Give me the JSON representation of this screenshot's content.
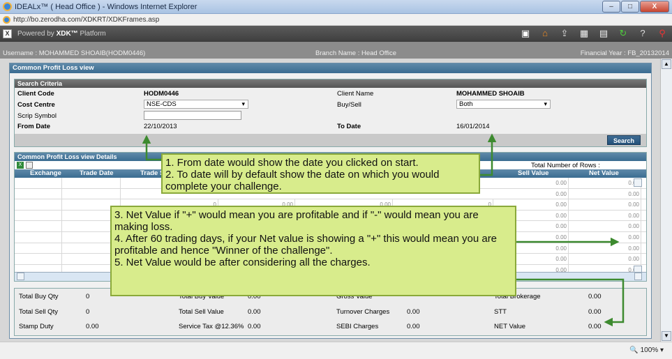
{
  "window": {
    "title": "IDEALx™ ( Head Office ) - Windows Internet Explorer",
    "minimize": "–",
    "maximize": "□",
    "close": "X"
  },
  "address": {
    "url": "http://bo.zerodha.com/XDKRT/XDKFrames.asp"
  },
  "platform": {
    "prefix": "Powered by ",
    "brand": "XDK™",
    "suffix": " Platform"
  },
  "userbar": {
    "username": "Username : MOHAMMED SHOAIB(HODM0446)",
    "branch": "Branch Name : Head Office",
    "fy": "Financial Year : FB_20132014"
  },
  "panel": {
    "title": "Common Profit Loss view"
  },
  "search": {
    "title": "Search Criteria",
    "client_code_label": "Client Code",
    "client_code": "HODM0446",
    "client_name_label": "Client Name",
    "client_name": "MOHAMMED SHOAIB",
    "cost_centre_label": "Cost Centre",
    "cost_centre": "NSE-CDS",
    "buy_sell_label": "Buy/Sell",
    "buy_sell": "Both",
    "scrip_label": "Scrip Symbol",
    "from_date_label": "From Date",
    "from_date": "22/10/2013",
    "to_date_label": "To Date",
    "to_date": "16/01/2014",
    "search_button": "Search"
  },
  "details": {
    "title": "Common Profit Loss view Details",
    "total_rows_label": "Total Number of Rows :",
    "columns": {
      "exchange": "Exchange",
      "trade_date": "Trade Date",
      "trade": "Trade S",
      "sell_value": "Sell Value",
      "net_value": "Net Value"
    },
    "zero": "0.00",
    "zero_int": "0"
  },
  "totals": {
    "total_buy_qty_label": "Total Buy Qty",
    "total_buy_qty": "0",
    "total_buy_value_label": "Total Buy Value",
    "total_buy_value": "0.00",
    "gross_value_label": "Gross Value",
    "total_brokerage_label": "Total Brokerage",
    "total_brokerage": "0.00",
    "total_sell_qty_label": "Total Sell Qty",
    "total_sell_qty": "0",
    "total_sell_value_label": "Total Sell Value",
    "total_sell_value": "0.00",
    "turnover_label": "Turnover Charges",
    "turnover": "0.00",
    "stt_label": "STT",
    "stt": "0.00",
    "stamp_duty_label": "Stamp Duty",
    "stamp_duty": "0.00",
    "service_tax_label": "Service Tax @12.36%",
    "service_tax": "0.00",
    "sebi_label": "SEBI Charges",
    "sebi": "0.00",
    "net_value_label": "NET Value",
    "net_value": "0.00"
  },
  "status": {
    "zoom": "100%"
  },
  "callouts": {
    "a1": "1. From date would show the date you clicked on start.",
    "a2": "2. To date will by default show the date on which you would complete your challenge.",
    "b3": "3. Net Value if \"+\" would mean you are profitable and if \"-\" would mean you are making loss.",
    "b4": "4. After 60 trading days, if your Net value is showing a \"+\" this would mean you are profitable and hence \"Winner of the challenge\".",
    "b5": "5. Net Value would be after considering all the charges."
  },
  "colors": {
    "callout_bg": "#d8ec8c",
    "arrow": "#3d8a2f",
    "header_blue": "#3a6c91"
  }
}
